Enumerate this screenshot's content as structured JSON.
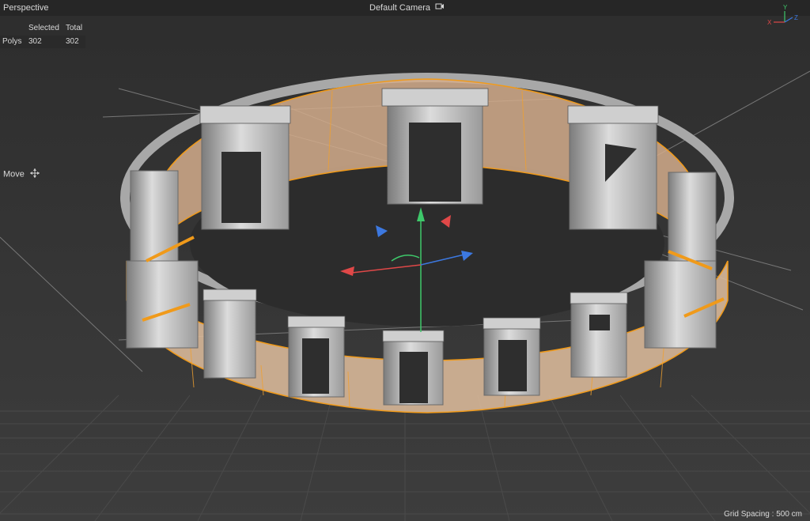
{
  "viewport": {
    "view_mode": "Perspective",
    "camera": "Default Camera",
    "camera_icon": "camera-icon",
    "grid_spacing": "Grid Spacing : 500 cm"
  },
  "hud": {
    "headers": {
      "selected": "Selected",
      "total": "Total"
    },
    "row": {
      "label": "Polys",
      "selected": "302",
      "total": "302"
    }
  },
  "tool": {
    "label": "Move",
    "icon": "move-icon"
  },
  "axis_gizmo": {
    "x": "X",
    "y": "Y",
    "z": "Z"
  },
  "colors": {
    "background": "#3a3a3a",
    "selection_orange": "#f09a1a",
    "axis_x": "#e04848",
    "axis_y": "#3ec86a",
    "axis_z": "#3c78e0"
  }
}
